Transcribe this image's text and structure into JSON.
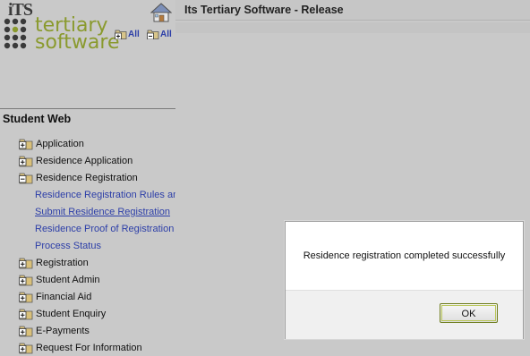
{
  "logo": {
    "top_text": "iTS",
    "word_line1": "tertiary",
    "word_line2": "software"
  },
  "toolbar": {
    "expand_all_label": "All",
    "collapse_all_label": "All"
  },
  "nav": {
    "section_title": "Student Web",
    "items": [
      {
        "label": "Application",
        "state": "collapsed"
      },
      {
        "label": "Residence Application",
        "state": "collapsed"
      },
      {
        "label": "Residence Registration",
        "state": "expanded",
        "children": [
          {
            "label": "Residence Registration Rules and"
          },
          {
            "label": "Submit Residence Registration"
          },
          {
            "label": "Residence Proof of Registration"
          },
          {
            "label": "Process Status"
          }
        ]
      },
      {
        "label": "Registration",
        "state": "collapsed"
      },
      {
        "label": "Student Admin",
        "state": "collapsed"
      },
      {
        "label": "Financial Aid",
        "state": "collapsed"
      },
      {
        "label": "Student Enquiry",
        "state": "collapsed"
      },
      {
        "label": "E-Payments",
        "state": "collapsed"
      },
      {
        "label": "Request For Information",
        "state": "collapsed"
      }
    ]
  },
  "header": {
    "title": "Its Tertiary Software - Release"
  },
  "dialog": {
    "message": "Residence registration completed successfully",
    "ok_label": "OK"
  },
  "colors": {
    "link_blue": "#2c3ea8",
    "logo_green": "#8a9a2e",
    "overlay_gray": "#c9c9c9"
  }
}
